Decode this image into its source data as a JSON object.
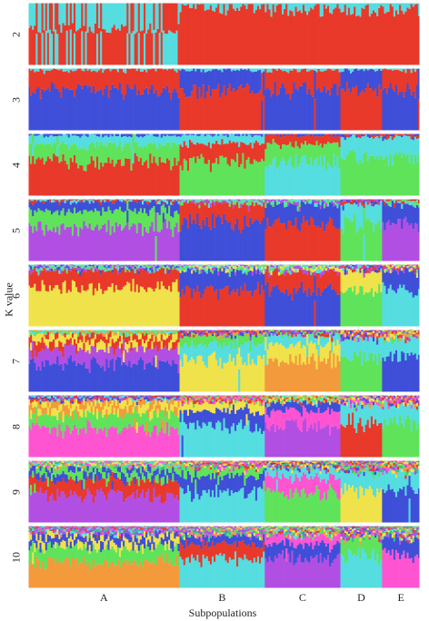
{
  "chart_data": {
    "type": "bar",
    "subtype": "stacked-admixture-structure-plot",
    "title": "",
    "xlabel": "Subpopulations",
    "ylabel": "K value",
    "ylim": [
      0,
      1
    ],
    "k_values": [
      "2",
      "3",
      "4",
      "5",
      "6",
      "7",
      "8",
      "9",
      "10"
    ],
    "subpopulations": [
      {
        "name": "A",
        "individuals": 80
      },
      {
        "name": "B",
        "individuals": 45
      },
      {
        "name": "C",
        "individuals": 40
      },
      {
        "name": "D",
        "individuals": 22
      },
      {
        "name": "E",
        "individuals": 20
      }
    ],
    "cluster_colors": [
      "#e8392a",
      "#55dde0",
      "#3f4fd8",
      "#5fe35a",
      "#b24fe3",
      "#f0e24a",
      "#f39a3c",
      "#ff54d2",
      "#2fc08a",
      "#8e5ae8"
    ],
    "panels": [
      {
        "k": "2",
        "dominant": {
          "A": [
            0,
            1
          ],
          "B": [
            0
          ],
          "C": [
            0
          ],
          "D": [
            0
          ],
          "E": [
            0
          ]
        },
        "typical_props": {
          "A": [
            0.55,
            0.45
          ],
          "B": [
            0.92,
            0.08
          ],
          "C": [
            0.9,
            0.1
          ],
          "D": [
            0.9,
            0.1
          ],
          "E": [
            0.9,
            0.1
          ]
        }
      },
      {
        "k": "3",
        "dominant": {
          "A": [
            3,
            0
          ],
          "B": [
            0,
            2
          ],
          "C": [
            2,
            0
          ],
          "D": [
            0,
            2
          ],
          "E": [
            2,
            0
          ]
        }
      },
      {
        "k": "4",
        "dominant": {
          "A": [
            0,
            3,
            1
          ],
          "B": [
            3,
            0,
            1
          ],
          "C": [
            1,
            3,
            0
          ],
          "D": [
            4,
            1
          ],
          "E": [
            4,
            1
          ]
        }
      },
      {
        "k": "5",
        "dominant": {
          "A": [
            4,
            3,
            2
          ],
          "B": [
            2,
            0
          ],
          "C": [
            0,
            2
          ],
          "D": [
            3,
            1
          ],
          "E": [
            5,
            2
          ]
        }
      },
      {
        "k": "6",
        "dominant": {
          "A": [
            7,
            0,
            5
          ],
          "B": [
            0,
            2
          ],
          "C": [
            2,
            0
          ],
          "D": [
            3,
            7
          ],
          "E": [
            1,
            2
          ]
        }
      },
      {
        "k": "7",
        "dominant": {
          "A": [
            2,
            4,
            5,
            0
          ],
          "B": [
            5,
            1,
            3
          ],
          "C": [
            7,
            5,
            1
          ],
          "D": [
            3,
            1
          ],
          "E": [
            2,
            1
          ]
        }
      },
      {
        "k": "8",
        "dominant": {
          "A": [
            7,
            3,
            5,
            6
          ],
          "B": [
            1,
            2,
            5
          ],
          "C": [
            4,
            7,
            2
          ],
          "D": [
            0,
            1
          ],
          "E": [
            3,
            1
          ]
        }
      },
      {
        "k": "9",
        "dominant": {
          "A": [
            4,
            0,
            3,
            2
          ],
          "B": [
            1,
            2,
            3
          ],
          "C": [
            3,
            7,
            1
          ],
          "D": [
            5,
            1
          ],
          "E": [
            2,
            1
          ]
        }
      },
      {
        "k": "10",
        "dominant": {
          "A": [
            6,
            3,
            5,
            2
          ],
          "B": [
            1,
            0,
            2
          ],
          "C": [
            4,
            2,
            7
          ],
          "D": [
            1,
            3
          ],
          "E": [
            7,
            2
          ]
        }
      }
    ],
    "grid": false,
    "legend": "none"
  }
}
